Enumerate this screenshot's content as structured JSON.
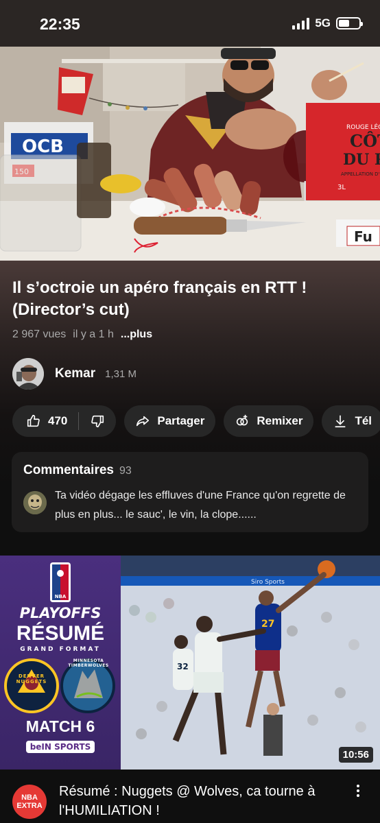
{
  "status_bar": {
    "time": "22:35",
    "network": "5G"
  },
  "video": {
    "title": "Il s’octroie un apéro français en RTT ! (Director’s cut)",
    "views": "2 967 vues",
    "age": "il y a 1 h",
    "more_label": "...plus",
    "scene_text": {
      "bottle_label_top": "ROUGE LÉG",
      "bottle_label_main": "CÔTE",
      "bottle_label_sub": "DU RHÔ",
      "bottle_label_small": "APPELLATION D'ORIG",
      "bottle_volume": "3L",
      "box_text": "Fu",
      "papers_brand": "OCB",
      "papers_count": "150"
    }
  },
  "channel": {
    "name": "Kemar",
    "subscribers": "1,31 M"
  },
  "actions": {
    "likes": "470",
    "share": "Partager",
    "remix": "Remixer",
    "download": "Tél"
  },
  "comments": {
    "label": "Commentaires",
    "count": "93",
    "top_comment": "Ta vidéo dégage les effluves d'une France qu'on regrette de plus en plus... le sauc', le vin, la clope......"
  },
  "next_video": {
    "duration": "10:56",
    "title": "Résumé : Nuggets @ Wolves, ca tourne à l'HUMILIATION !",
    "channel_badge_line1": "NBA",
    "channel_badge_line2": "EXTRA",
    "thumbnail_text": {
      "nba": "NBA",
      "playoffs": "PLAYOFFS",
      "resume": "RÉSUMÉ",
      "format": "GRAND FORMAT",
      "team_left": "DENVER NUGGETS",
      "team_right": "MINNESOTA TIMBERWOLVES",
      "match": "MATCH 6",
      "broadcaster": "beIN SPORTS",
      "jersey_left": "32",
      "jersey_right": "27",
      "arena_banner": "Siro Sports"
    }
  },
  "colors": {
    "background": "#0f0f0f",
    "pill": "#272727",
    "comments_card": "#1e1d1d",
    "nba_purple": "#4a2f7e",
    "nba_red": "#e53935"
  }
}
